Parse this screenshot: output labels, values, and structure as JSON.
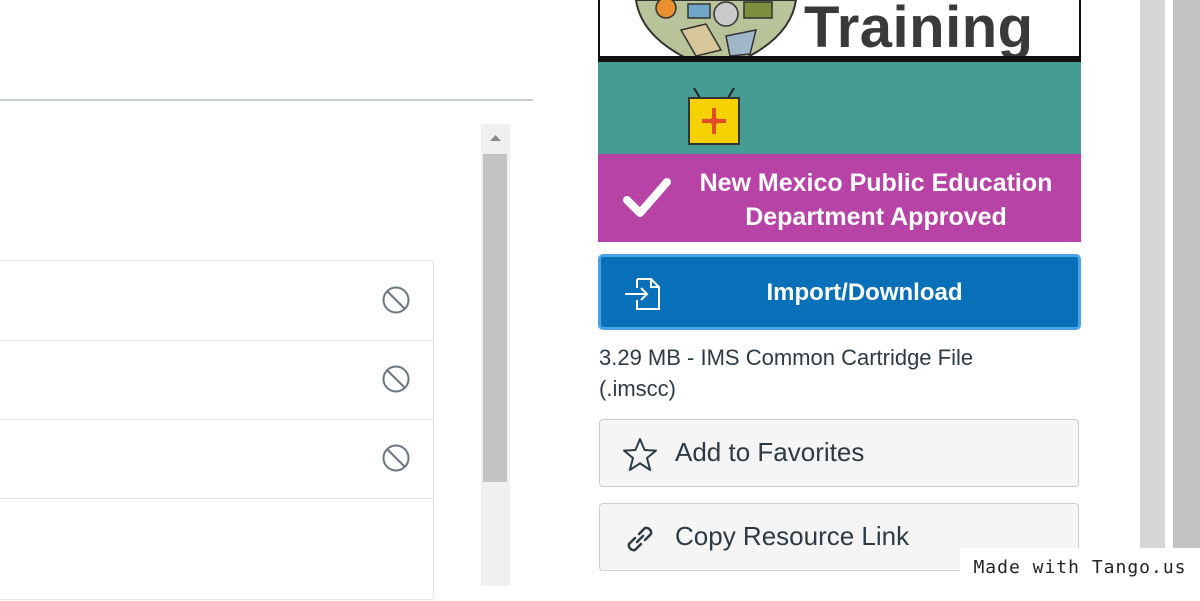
{
  "hero": {
    "title": "Training",
    "approved_line1": "New Mexico Public Education",
    "approved_line2": "Department Approved",
    "colors": {
      "teal": "#469c93",
      "magenta": "#b843a6"
    }
  },
  "import_button": {
    "label": "Import/Download",
    "icon": "file-import-icon",
    "color": "#0770b8"
  },
  "file_info": {
    "line1": "3.29 MB - IMS Common Cartridge File",
    "line2": "(.imscc)"
  },
  "favorites_button": {
    "label": "Add to Favorites",
    "icon": "star-outline-icon"
  },
  "copy_link_button": {
    "label": "Copy Resource Link",
    "icon": "link-icon"
  },
  "list": {
    "rows": [
      {
        "status_icon": "not-allowed-icon"
      },
      {
        "status_icon": "not-allowed-icon"
      },
      {
        "status_icon": "not-allowed-icon"
      },
      {
        "status_icon": ""
      }
    ]
  },
  "watermark": {
    "text": "Made with Tango.us"
  }
}
